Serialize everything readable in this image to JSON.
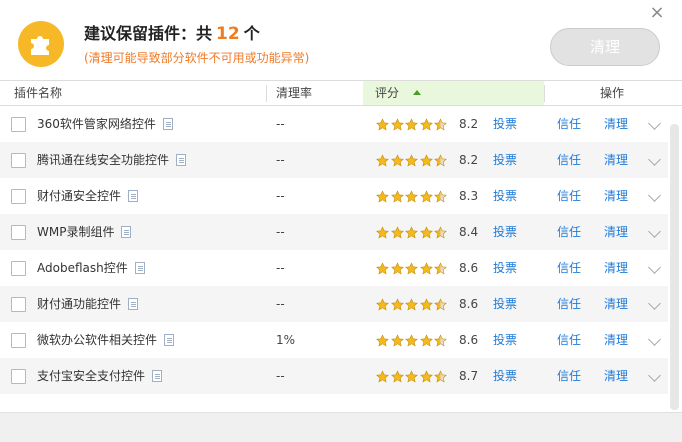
{
  "header": {
    "title_prefix": "建议保留插件：共",
    "count": "12",
    "title_suffix": "个",
    "subtitle": "(清理可能导致部分软件不可用或功能异常)",
    "clean_button": "清理",
    "close_icon": "×"
  },
  "columns": {
    "name": "插件名称",
    "rate": "清理率",
    "score": "评分",
    "op": "操作"
  },
  "colors": {
    "accent_orange": "#f07c22",
    "link_blue": "#1f7ad8",
    "star_gold": "#f4b91b",
    "sort_column_bg": "#e9f7dd"
  },
  "rows": [
    {
      "name": "360软件管家网络控件",
      "rate": "--",
      "stars": 4.5,
      "score": "8.2",
      "vote": "投票",
      "trust": "信任",
      "clean": "清理"
    },
    {
      "name": "腾讯通在线安全功能控件",
      "rate": "--",
      "stars": 4.5,
      "score": "8.2",
      "vote": "投票",
      "trust": "信任",
      "clean": "清理"
    },
    {
      "name": "财付通安全控件",
      "rate": "--",
      "stars": 4.5,
      "score": "8.3",
      "vote": "投票",
      "trust": "信任",
      "clean": "清理"
    },
    {
      "name": "WMP录制组件",
      "rate": "--",
      "stars": 4.5,
      "score": "8.4",
      "vote": "投票",
      "trust": "信任",
      "clean": "清理"
    },
    {
      "name": "Adobeflash控件",
      "rate": "--",
      "stars": 4.5,
      "score": "8.6",
      "vote": "投票",
      "trust": "信任",
      "clean": "清理"
    },
    {
      "name": "财付通功能控件",
      "rate": "--",
      "stars": 4.5,
      "score": "8.6",
      "vote": "投票",
      "trust": "信任",
      "clean": "清理"
    },
    {
      "name": "微软办公软件相关控件",
      "rate": "1%",
      "stars": 4.5,
      "score": "8.6",
      "vote": "投票",
      "trust": "信任",
      "clean": "清理"
    },
    {
      "name": "支付宝安全支付控件",
      "rate": "--",
      "stars": 4.5,
      "score": "8.7",
      "vote": "投票",
      "trust": "信任",
      "clean": "清理"
    }
  ]
}
